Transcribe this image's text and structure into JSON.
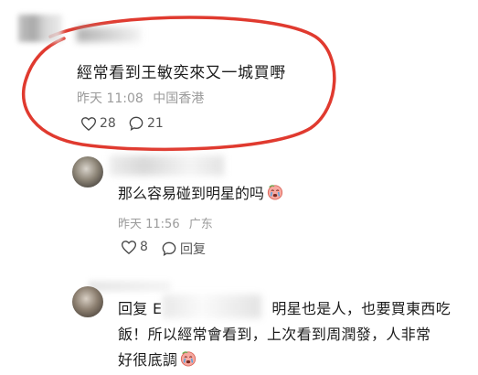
{
  "comment_1": {
    "text": "經常看到王敏奕來又一城買嘢",
    "time": "昨天 11:08",
    "location": "中国香港",
    "likes": "28",
    "replies": "21"
  },
  "reply_1": {
    "text": "那么容易碰到明星的吗",
    "emoji": "crying-face-emoji",
    "time": "昨天 11:56",
    "location": "广东",
    "likes": "8",
    "reply_label": "回复"
  },
  "reply_2": {
    "prefix": "回复 E",
    "line1": "明星也是人，也要買東西吃",
    "line2": "飯！所以經常會看到，上次看到周潤發，人非常",
    "line3": "好很底調",
    "emoji": "crying-face-emoji"
  },
  "colors": {
    "highlight_ring": "#e03a2f",
    "meta_text": "#9b9b9b",
    "body_text": "#1c1c1c"
  }
}
